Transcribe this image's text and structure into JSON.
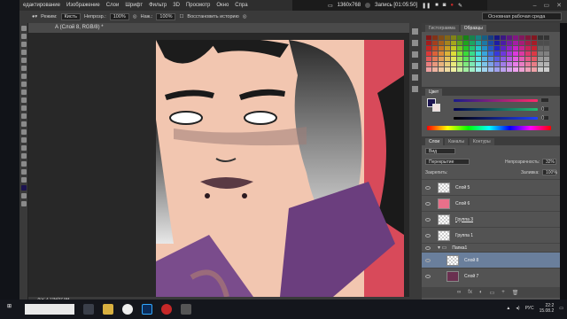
{
  "menu": {
    "items": [
      "едактирование",
      "Изображение",
      "Слои",
      "Шрифт",
      "Фильтр",
      "3D",
      "Просмотр",
      "Окно",
      "Спра"
    ]
  },
  "recorder": {
    "resolution": "1360x768",
    "status": "Запись [01:05:50]"
  },
  "options": {
    "mode_label": "Режим:",
    "mode_value": "Кисть",
    "opacity_label": "Непрозр.:",
    "opacity_value": "100%",
    "press_label": "Наж.:",
    "press_value": "100%",
    "history_label": "Восстановить историю",
    "workspace": "Основная рабочая среда"
  },
  "document": {
    "tab_title": "А (Слой 8, RGB/8) *",
    "status": "Док: 4,12М/37,9М"
  },
  "panels": {
    "tab_histogram": "Гистограмма",
    "tab_swatches": "Образцы",
    "color_title": "Цвет",
    "tab_layers": "Слои",
    "tab_channels": "Каналы",
    "tab_paths": "Контуры",
    "kind": "Вид",
    "blend_mode": "Перекрытие",
    "opacity_label": "Непрозрачность:",
    "opacity": "32%",
    "lock_label": "Закрепить:",
    "fill_label": "Заливка:",
    "fill": "100%",
    "color_values": [
      "",
      "0",
      "0"
    ]
  },
  "layers": [
    {
      "name": "Слой 5",
      "selected": false
    },
    {
      "name": "Слой 6",
      "selected": false
    },
    {
      "name": "Группа 3",
      "selected": false
    },
    {
      "name": "Группа 1",
      "selected": false
    },
    {
      "name": "Папка1",
      "selected": false
    },
    {
      "name": "Слой 8",
      "selected": true
    },
    {
      "name": "Слой 7",
      "selected": false
    }
  ],
  "taskbar": {
    "search_placeholder": "",
    "lang": "РУС",
    "time": "22:2",
    "date": "15.08.2"
  },
  "colors": {
    "accent": "#6a7f9c",
    "foreground": "#1c1450",
    "background": "#f0e0e0",
    "record": "#c62828"
  }
}
